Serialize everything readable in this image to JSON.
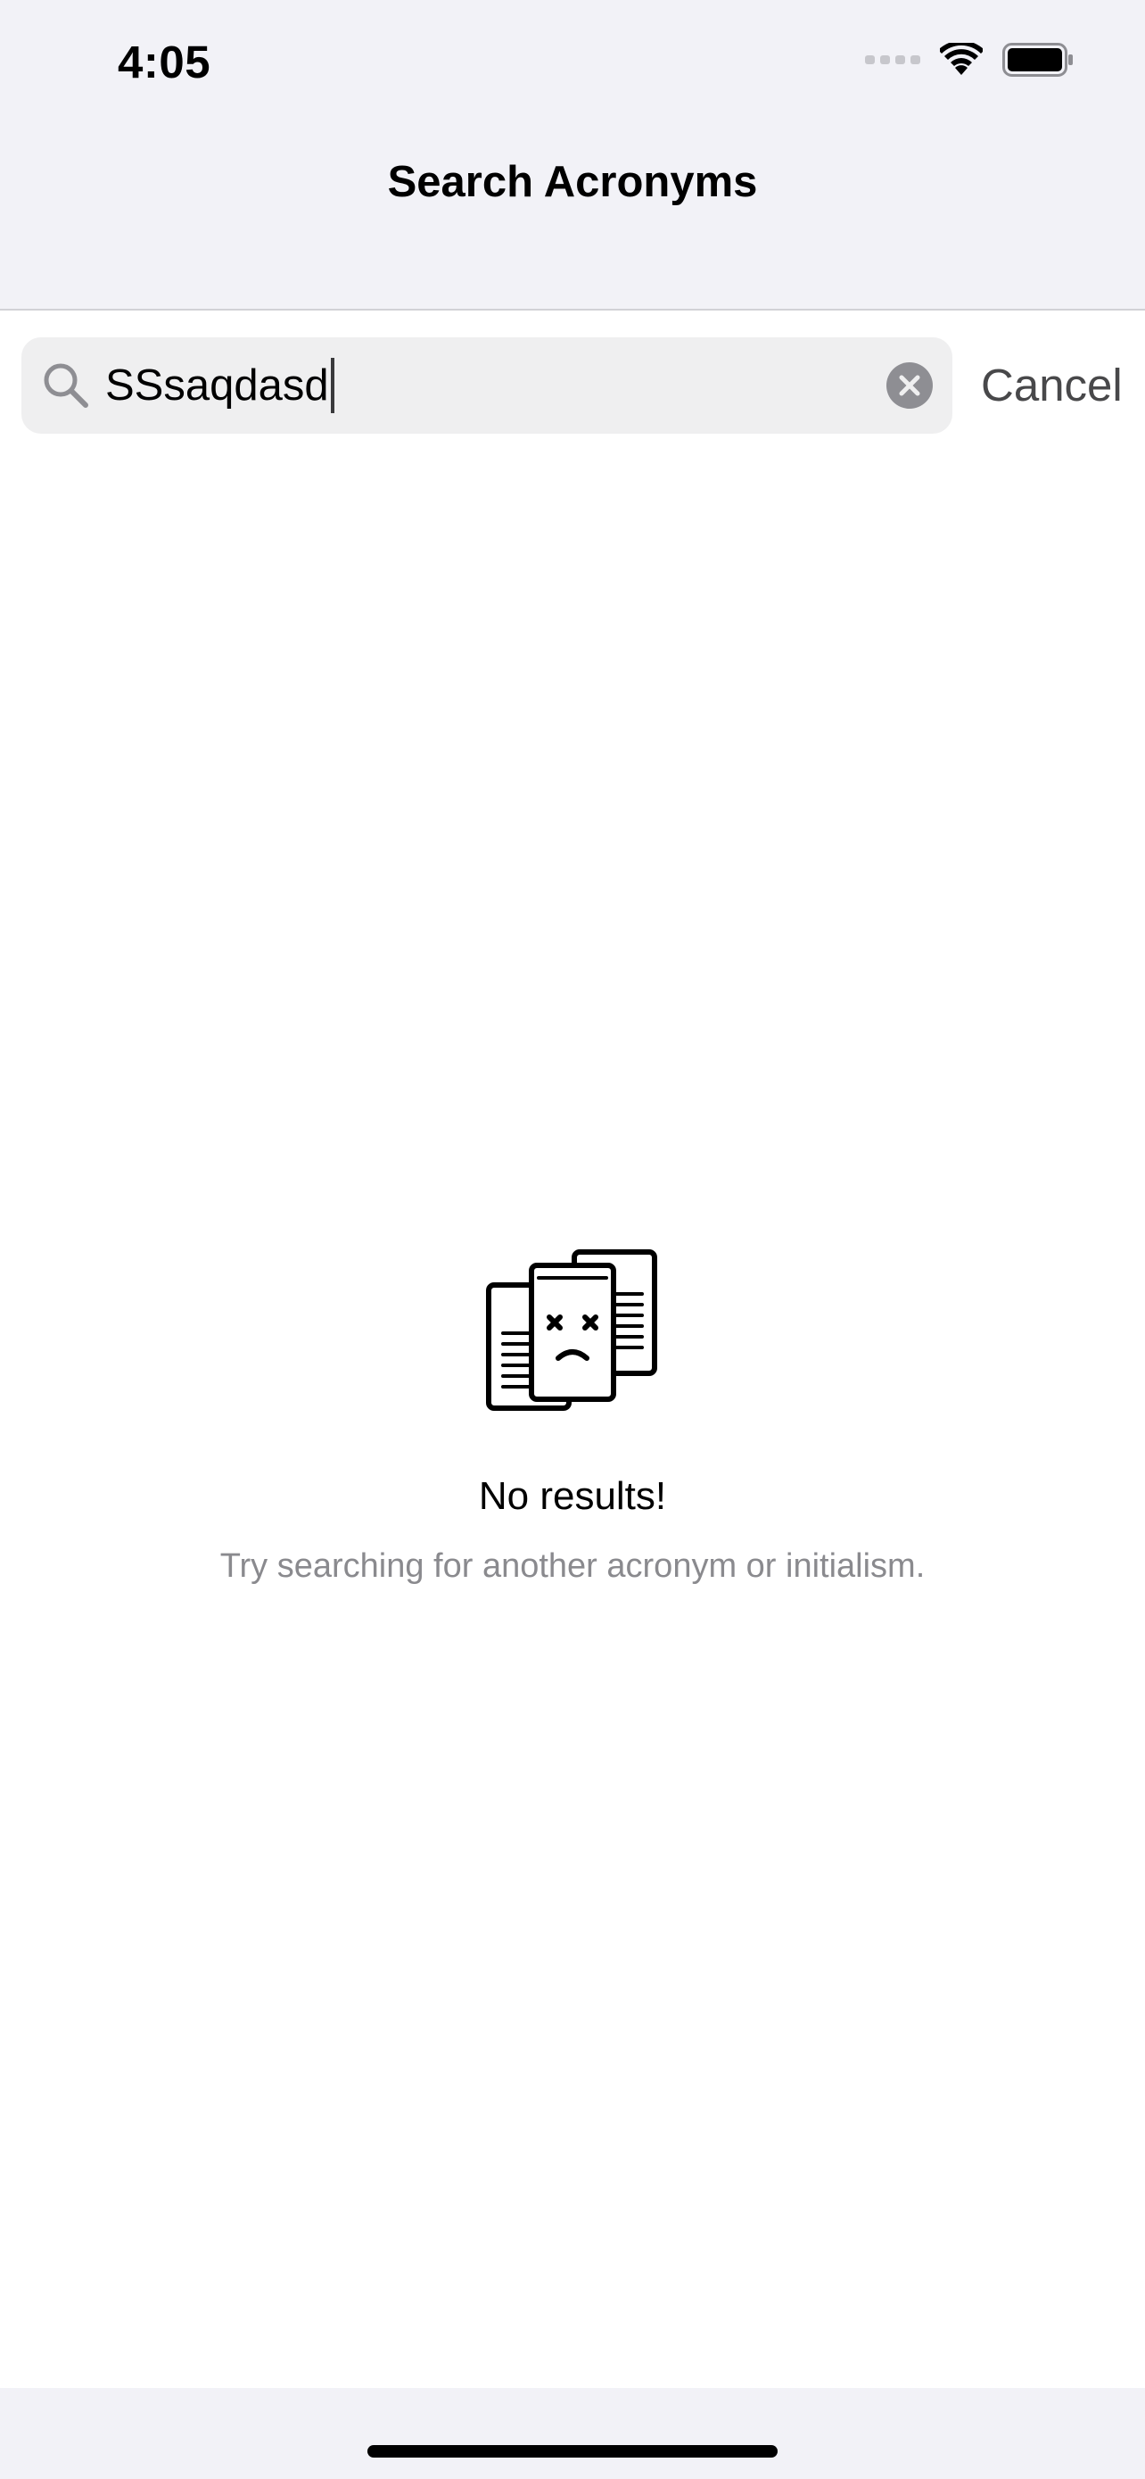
{
  "status_bar": {
    "time": "4:05",
    "icons": [
      "cellular-signal-icon",
      "wifi-icon",
      "battery-icon"
    ]
  },
  "nav": {
    "title": "Search Acronyms"
  },
  "search": {
    "value": "SSsaqdasd",
    "cancel_label": "Cancel",
    "icons": [
      "search-icon",
      "clear-icon"
    ]
  },
  "empty_state": {
    "icon": "no-results-documents-icon",
    "title": "No results!",
    "subtitle": "Try searching for another acronym or initialism."
  },
  "colors": {
    "top_background": "#f2f2f7",
    "search_field": "#efeff0",
    "cancel_text": "#48484a",
    "subtitle_text": "#8a8a8e"
  }
}
